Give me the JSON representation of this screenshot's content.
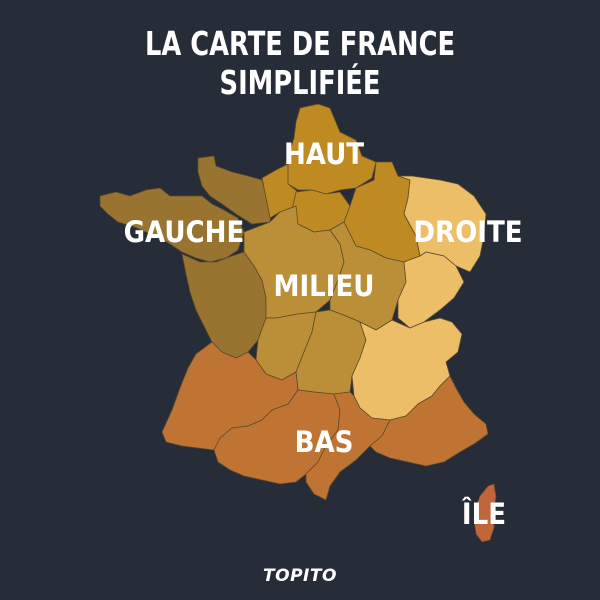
{
  "title": "LA CARTE DE FRANCE SIMPLIFIÉE",
  "zones": {
    "haut": {
      "label": "HAUT",
      "color": "#c08a22"
    },
    "gauche": {
      "label": "GAUCHE",
      "color": "#987430"
    },
    "droite": {
      "label": "DROITE",
      "color": "#ebbe67"
    },
    "milieu": {
      "label": "MILIEU",
      "color": "#bb8f37"
    },
    "bas": {
      "label": "BAS",
      "color": "#c07434"
    },
    "ile": {
      "label": "ÎLE",
      "color": "#c0663a"
    }
  },
  "brand": "TOPITO",
  "background": "#262c38"
}
